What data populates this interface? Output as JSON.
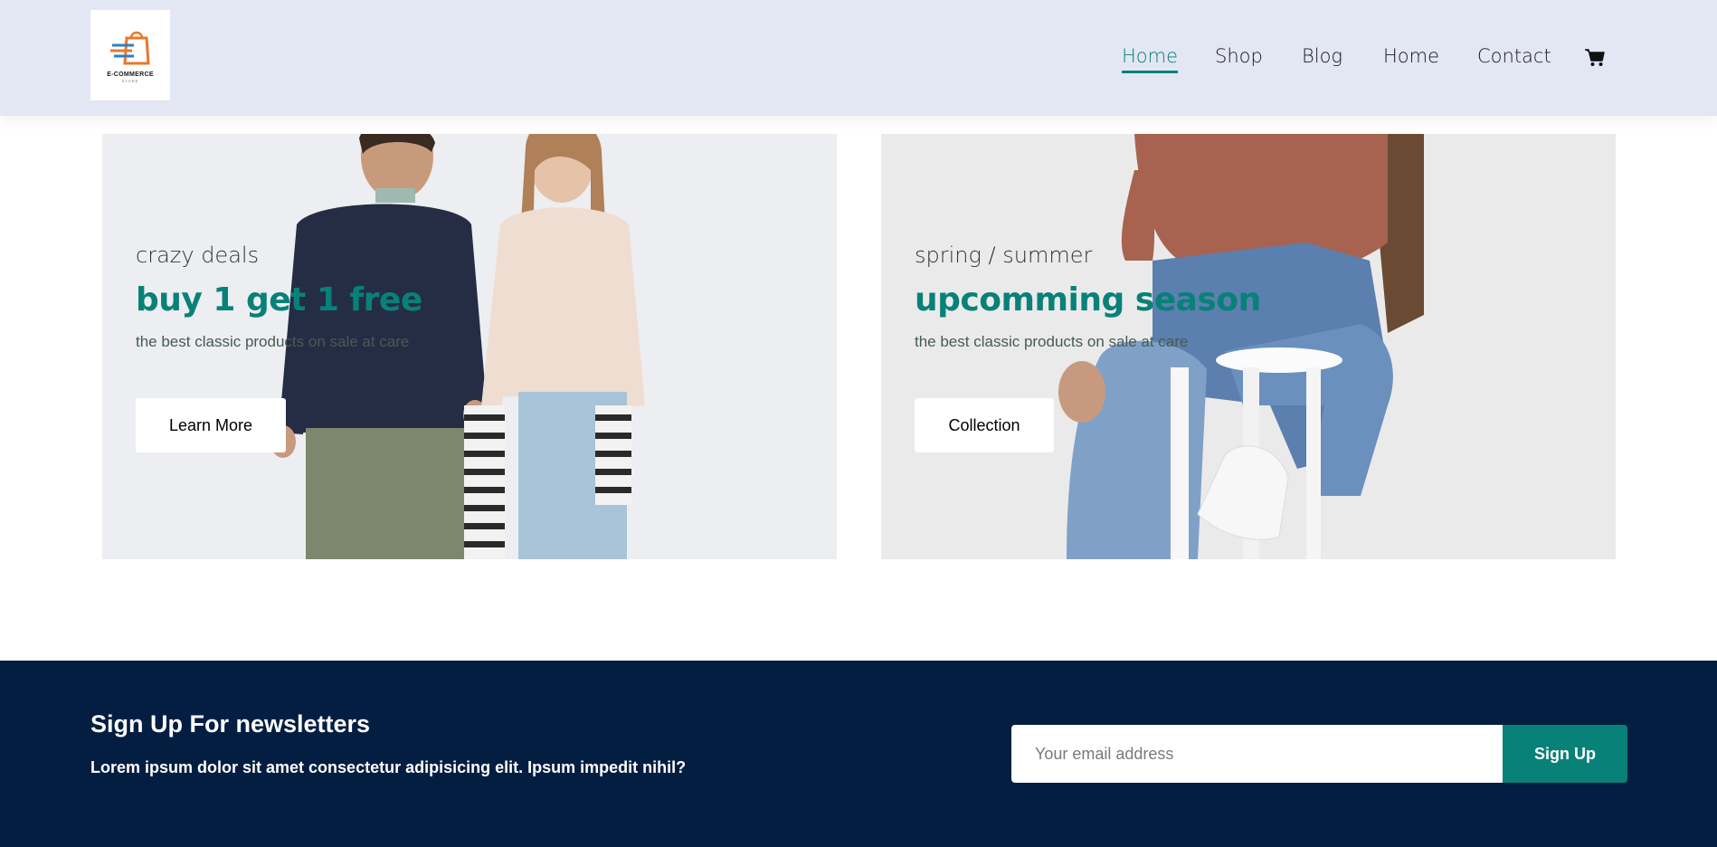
{
  "brand": {
    "logo_text": "E-COMMERCE",
    "logo_sub": "STORE",
    "colors": {
      "accent": "#088178",
      "header_bg": "#e3e6f3",
      "newsletter_bg": "#041e42"
    }
  },
  "nav": {
    "items": [
      {
        "label": "Home",
        "active": true
      },
      {
        "label": "Shop",
        "active": false
      },
      {
        "label": "Blog",
        "active": false
      },
      {
        "label": "Home",
        "active": false
      },
      {
        "label": "Contact",
        "active": false
      }
    ],
    "cart_icon": "cart-icon"
  },
  "banners": [
    {
      "kicker": "crazy deals",
      "title": "buy 1 get 1 free",
      "description": "the best classic products on sale at care",
      "button": "Learn More"
    },
    {
      "kicker": "spring / summer",
      "title": "upcomming season",
      "description": "the best classic products on sale at care",
      "button": "Collection"
    }
  ],
  "newsletter": {
    "title": "Sign Up For newsletters",
    "text": "Lorem ipsum dolor sit amet consectetur adipisicing elit. Ipsum impedit nihil?",
    "placeholder": "Your email address",
    "button": "Sign Up"
  }
}
